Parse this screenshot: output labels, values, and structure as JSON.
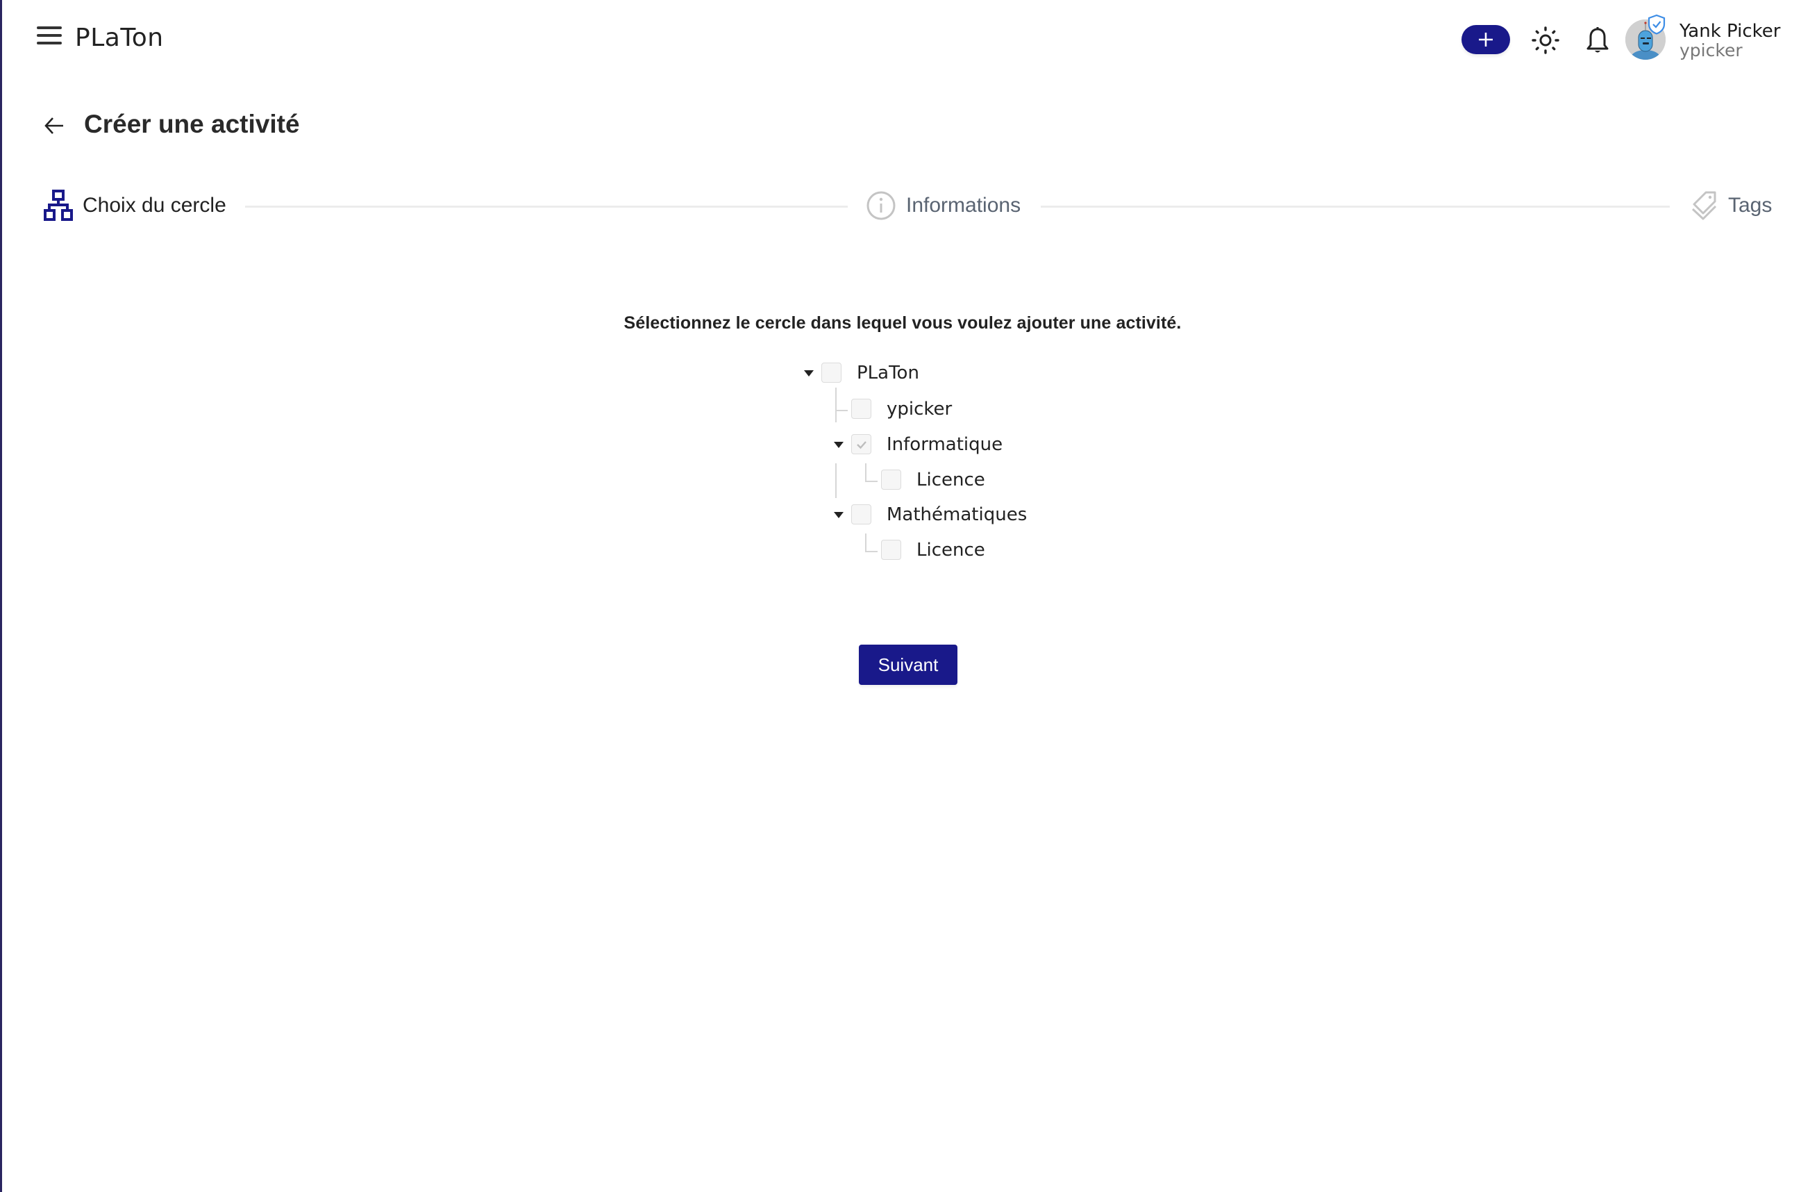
{
  "header": {
    "app_title": "PLaTon",
    "menu_icon": "hamburger-menu-icon",
    "add_button_icon": "plus-icon",
    "theme_toggle_icon": "sun-icon",
    "notifications_icon": "bell-icon",
    "user": {
      "name": "Yank Picker",
      "username": "ypicker",
      "avatar_icon": "robot-avatar",
      "verified_badge_icon": "shield-check-icon"
    }
  },
  "page": {
    "back_icon": "arrow-left-icon",
    "title": "Créer une activité"
  },
  "stepper": {
    "steps": [
      {
        "label": "Choix du cercle",
        "icon": "sitemap-icon",
        "state": "active",
        "color": "#19198a"
      },
      {
        "label": "Informations",
        "icon": "info-circle-icon",
        "state": "inactive",
        "color": "#c4c4c4"
      },
      {
        "label": "Tags",
        "icon": "tags-icon",
        "state": "inactive",
        "color": "#c4c4c4"
      }
    ]
  },
  "content": {
    "instruction": "Sélectionnez le cercle dans lequel vous voulez ajouter une activité.",
    "tree": [
      {
        "label": "PLaTon",
        "level": 0,
        "expanded": true,
        "checked": false
      },
      {
        "label": "ypicker",
        "level": 1,
        "expanded": null,
        "checked": false
      },
      {
        "label": "Informatique",
        "level": 1,
        "expanded": true,
        "checked": true,
        "disabled": true
      },
      {
        "label": "Licence",
        "level": 2,
        "expanded": null,
        "checked": false
      },
      {
        "label": "Mathématiques",
        "level": 1,
        "expanded": true,
        "checked": false
      },
      {
        "label": "Licence",
        "level": 2,
        "expanded": null,
        "checked": false
      }
    ],
    "next_button": "Suivant"
  },
  "colors": {
    "primary": "#19198a",
    "sidebar_edge": "#2a2560",
    "muted_step": "#5a6472",
    "step_icon_inactive": "#c4c4c4"
  }
}
